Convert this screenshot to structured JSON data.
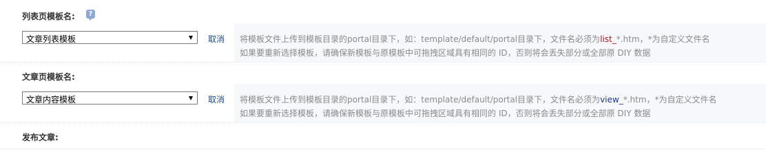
{
  "sections": [
    {
      "title": "列表页模板名:",
      "select_value": "文章列表模板",
      "cancel_label": "取消",
      "tip1_prefix": "将模板文件上传到模板目录的portal目录下，如：template/default/portal目录下，文件名必须为",
      "tip1_highlight": "list_",
      "tip1_suffix": "*.htm，*为自定义文件名",
      "tip2": "如果要重新选择模板，请确保新模板与原模板中可拖拽区域具有相同的 ID，否则将会丢失部分或全部原 DIY 数据"
    },
    {
      "title": "文章页模板名:",
      "select_value": "文章内容模板",
      "cancel_label": "取消",
      "tip1_prefix": "将模板文件上传到模板目录的portal目录下，如：template/default/portal目录下，文件名必须为",
      "tip1_highlight": "view_",
      "tip1_suffix": "*.htm，*为自定义文件名",
      "tip2": "如果要重新选择模板，请确保新模板与原模板中可拖拽区域具有相同的 ID，否则将会丢失部分或全部原 DIY 数据"
    }
  ],
  "publish_title": "发布文章:",
  "icons": {
    "help": "help-icon",
    "dropdown": "chevron-down-icon"
  },
  "colors": {
    "link": "#1c4b8a",
    "highlight_red": "#b0121f",
    "highlight_blue": "#1a3a8f",
    "tip_gray": "#8a8a8a",
    "row_bg": "#f6f8fb"
  }
}
